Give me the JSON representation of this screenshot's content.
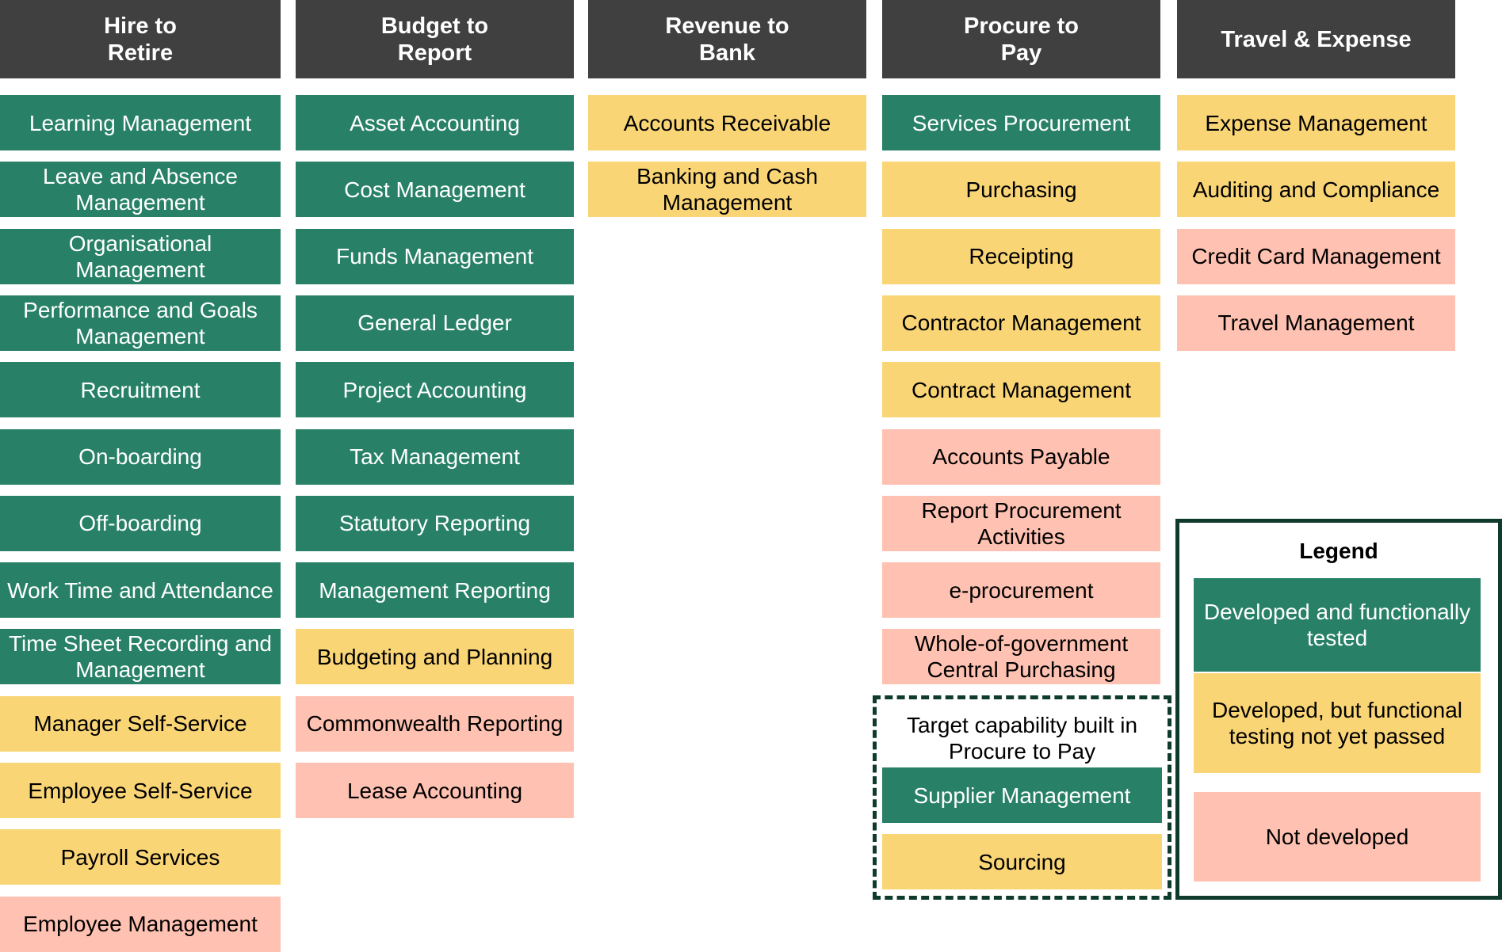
{
  "status_colors": {
    "green": "#288166",
    "yellow": "#F9D576",
    "pink": "#FFC1B1",
    "header": "#404040",
    "border": "#0E3B2C"
  },
  "columns": [
    {
      "title": "Hire to\nRetire",
      "items": [
        {
          "label": "Learning Management",
          "status": "green"
        },
        {
          "label": "Leave and Absence Management",
          "status": "green"
        },
        {
          "label": "Organisational Management",
          "status": "green"
        },
        {
          "label": "Performance and Goals Management",
          "status": "green"
        },
        {
          "label": "Recruitment",
          "status": "green"
        },
        {
          "label": "On-boarding",
          "status": "green"
        },
        {
          "label": "Off-boarding",
          "status": "green"
        },
        {
          "label": "Work Time and Attendance",
          "status": "green"
        },
        {
          "label": "Time Sheet Recording and Management",
          "status": "green"
        },
        {
          "label": "Manager Self-Service",
          "status": "yellow"
        },
        {
          "label": "Employee Self-Service",
          "status": "yellow"
        },
        {
          "label": "Payroll Services",
          "status": "yellow"
        },
        {
          "label": "Employee Management",
          "status": "pink"
        }
      ]
    },
    {
      "title": "Budget to\nReport",
      "items": [
        {
          "label": "Asset Accounting",
          "status": "green"
        },
        {
          "label": "Cost Management",
          "status": "green"
        },
        {
          "label": "Funds Management",
          "status": "green"
        },
        {
          "label": "General Ledger",
          "status": "green"
        },
        {
          "label": "Project Accounting",
          "status": "green"
        },
        {
          "label": "Tax Management",
          "status": "green"
        },
        {
          "label": "Statutory Reporting",
          "status": "green"
        },
        {
          "label": "Management Reporting",
          "status": "green"
        },
        {
          "label": "Budgeting and Planning",
          "status": "yellow"
        },
        {
          "label": "Commonwealth Reporting",
          "status": "pink"
        },
        {
          "label": "Lease Accounting",
          "status": "pink"
        }
      ]
    },
    {
      "title": "Revenue to\nBank",
      "items": [
        {
          "label": "Accounts Receivable",
          "status": "yellow"
        },
        {
          "label": "Banking and Cash Management",
          "status": "yellow"
        }
      ]
    },
    {
      "title": "Procure to\nPay",
      "items": [
        {
          "label": "Services Procurement",
          "status": "green"
        },
        {
          "label": "Purchasing",
          "status": "yellow"
        },
        {
          "label": "Receipting",
          "status": "yellow"
        },
        {
          "label": "Contractor Management",
          "status": "yellow"
        },
        {
          "label": "Contract Management",
          "status": "yellow"
        },
        {
          "label": "Accounts Payable",
          "status": "pink"
        },
        {
          "label": "Report Procurement Activities",
          "status": "pink"
        },
        {
          "label": "e-procurement",
          "status": "pink"
        },
        {
          "label": "Whole-of-government Central Purchasing",
          "status": "pink"
        }
      ]
    },
    {
      "title": "Travel & Expense",
      "items": [
        {
          "label": "Expense Management",
          "status": "yellow"
        },
        {
          "label": "Auditing and Compliance",
          "status": "yellow"
        },
        {
          "label": "Credit Card Management",
          "status": "pink"
        },
        {
          "label": "Travel Management",
          "status": "pink"
        }
      ]
    }
  ],
  "target_group": {
    "caption": "Target capability built in Procure to Pay",
    "items": [
      {
        "label": "Supplier Management",
        "status": "green"
      },
      {
        "label": "Sourcing",
        "status": "yellow"
      }
    ]
  },
  "legend": {
    "title": "Legend",
    "items": [
      {
        "label": "Developed and functionally tested",
        "status": "green"
      },
      {
        "label": "Developed, but functional testing not yet passed",
        "status": "yellow"
      },
      {
        "label": "Not developed",
        "status": "pink"
      }
    ]
  }
}
